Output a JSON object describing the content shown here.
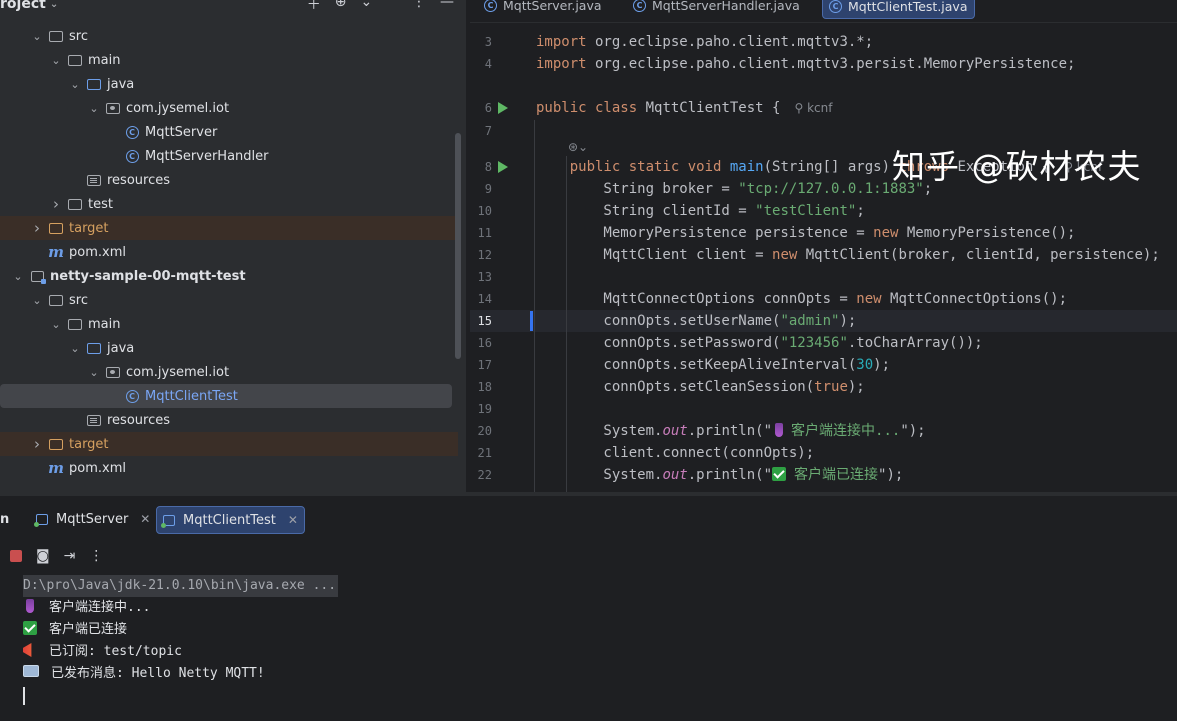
{
  "project_panel": {
    "title": "roject",
    "tree": [
      {
        "label": "src",
        "type": "folder",
        "depth": 2,
        "expanded": true
      },
      {
        "label": "main",
        "type": "folder",
        "depth": 3,
        "expanded": true
      },
      {
        "label": "java",
        "type": "folder-blue",
        "depth": 4,
        "expanded": true
      },
      {
        "label": "com.jysemel.iot",
        "type": "package",
        "depth": 5,
        "expanded": true
      },
      {
        "label": "MqttServer",
        "type": "class",
        "depth": 6
      },
      {
        "label": "MqttServerHandler",
        "type": "class",
        "depth": 6
      },
      {
        "label": "resources",
        "type": "resources",
        "depth": 4
      },
      {
        "label": "test",
        "type": "folder",
        "depth": 3,
        "expanded": false
      },
      {
        "label": "target",
        "type": "folder-orange",
        "depth": 2,
        "expanded": false,
        "excluded": true
      },
      {
        "label": "pom.xml",
        "type": "maven",
        "depth": 2
      },
      {
        "label": "netty-sample-00-mqtt-test",
        "type": "module",
        "depth": 1,
        "expanded": true,
        "bold": true
      },
      {
        "label": "src",
        "type": "folder",
        "depth": 2,
        "expanded": true
      },
      {
        "label": "main",
        "type": "folder",
        "depth": 3,
        "expanded": true
      },
      {
        "label": "java",
        "type": "folder-blue",
        "depth": 4,
        "expanded": true
      },
      {
        "label": "com.jysemel.iot",
        "type": "package",
        "depth": 5,
        "expanded": true
      },
      {
        "label": "MqttClientTest",
        "type": "class",
        "depth": 6,
        "selected": true
      },
      {
        "label": "resources",
        "type": "resources",
        "depth": 4
      },
      {
        "label": "target",
        "type": "folder-orange",
        "depth": 2,
        "expanded": false,
        "excluded": true
      },
      {
        "label": "pom.xml",
        "type": "maven",
        "depth": 2
      }
    ]
  },
  "editor": {
    "tabs": [
      {
        "label": "MqttServer.java",
        "active": false
      },
      {
        "label": "MqttServerHandler.java",
        "active": false
      },
      {
        "label": "MqttClientTest.java",
        "active": true
      }
    ],
    "current_line": "15",
    "author_hint": "kcnf",
    "lines": [
      {
        "n": "3",
        "code": [
          [
            "kw",
            "import"
          ],
          [
            "p",
            " org.eclipse.paho.client.mqttv3.*;"
          ]
        ]
      },
      {
        "n": "4",
        "code": [
          [
            "kw",
            "import"
          ],
          [
            "p",
            " org.eclipse.paho.client.mqttv3.persist.MemoryPersistence;"
          ]
        ]
      },
      {
        "n": "6",
        "run": true,
        "hint": true,
        "code": [
          [
            "kw",
            "public class"
          ],
          [
            "p",
            " MqttClientTest {"
          ]
        ]
      },
      {
        "n": "7",
        "code": []
      },
      {
        "n": "8",
        "run": true,
        "hint": true,
        "code": [
          [
            "p",
            "    "
          ],
          [
            "kw",
            "public static void"
          ],
          [
            "p",
            " "
          ],
          [
            "fn",
            "main"
          ],
          [
            "p",
            "(String[] args) "
          ],
          [
            "kw",
            "throws"
          ],
          [
            "p",
            " Exception {"
          ]
        ]
      },
      {
        "n": "9",
        "code": [
          [
            "p",
            "        String broker = "
          ],
          [
            "str",
            "\"tcp://127.0.0.1:1883\""
          ],
          [
            "p",
            ";"
          ]
        ]
      },
      {
        "n": "10",
        "code": [
          [
            "p",
            "        String clientId = "
          ],
          [
            "str",
            "\"testClient\""
          ],
          [
            "p",
            ";"
          ]
        ]
      },
      {
        "n": "11",
        "code": [
          [
            "p",
            "        MemoryPersistence persistence = "
          ],
          [
            "kw",
            "new"
          ],
          [
            "p",
            " MemoryPersistence();"
          ]
        ]
      },
      {
        "n": "12",
        "code": [
          [
            "p",
            "        MqttClient client = "
          ],
          [
            "kw",
            "new"
          ],
          [
            "p",
            " MqttClient(broker, clientId, persistence);"
          ]
        ]
      },
      {
        "n": "13",
        "code": []
      },
      {
        "n": "14",
        "code": [
          [
            "p",
            "        MqttConnectOptions connOpts = "
          ],
          [
            "kw",
            "new"
          ],
          [
            "p",
            " MqttConnectOptions();"
          ]
        ]
      },
      {
        "n": "15",
        "code": [
          [
            "p",
            "        connOpts.setUserName("
          ],
          [
            "str",
            "\"admin\""
          ],
          [
            "p",
            ");"
          ]
        ]
      },
      {
        "n": "16",
        "code": [
          [
            "p",
            "        connOpts.setPassword("
          ],
          [
            "str",
            "\"123456\""
          ],
          [
            "p",
            ".toCharArray());"
          ]
        ]
      },
      {
        "n": "17",
        "code": [
          [
            "p",
            "        connOpts.setKeepAliveInterval("
          ],
          [
            "num",
            "30"
          ],
          [
            "p",
            ");"
          ]
        ]
      },
      {
        "n": "18",
        "code": [
          [
            "p",
            "        connOpts.setCleanSession("
          ],
          [
            "kw",
            "true"
          ],
          [
            "p",
            ");"
          ]
        ]
      },
      {
        "n": "19",
        "code": []
      },
      {
        "n": "20",
        "code": [
          [
            "p",
            "        System."
          ],
          [
            "fld",
            "out"
          ],
          [
            "p",
            ".println(\""
          ],
          [
            "emoji",
            "plug"
          ],
          [
            "str",
            "客户端连接中..."
          ],
          [
            "p",
            "\");"
          ]
        ]
      },
      {
        "n": "21",
        "code": [
          [
            "p",
            "        client.connect(connOpts);"
          ]
        ]
      },
      {
        "n": "22",
        "code": [
          [
            "p",
            "        System."
          ],
          [
            "fld",
            "out"
          ],
          [
            "p",
            ".println(\""
          ],
          [
            "emoji",
            "check"
          ],
          [
            "str",
            "客户端已连接"
          ],
          [
            "p",
            "\");"
          ]
        ]
      }
    ]
  },
  "run_panel": {
    "title_fragment": "n",
    "tabs": [
      {
        "label": "MqttServer",
        "active": false,
        "close": "✕"
      },
      {
        "label": "MqttClientTest",
        "active": true,
        "close": "✕"
      }
    ],
    "output": [
      {
        "text": "D:\\pro\\Java\\jdk-21.0.10\\bin\\java.exe ...",
        "emoji": null,
        "cmd": true
      },
      {
        "text": "客户端连接中...",
        "emoji": "plug"
      },
      {
        "text": "客户端已连接",
        "emoji": "check"
      },
      {
        "text": "已订阅: test/topic",
        "emoji": "megaphone"
      },
      {
        "text": "已发布消息: Hello Netty MQTT!",
        "emoji": "mail"
      }
    ]
  },
  "watermark": "知乎 @砍材农夫",
  "colors": {
    "accent": "#3574f0",
    "run_green": "#5fb865",
    "keyword": "#cf8e6d",
    "string": "#6aab73"
  }
}
